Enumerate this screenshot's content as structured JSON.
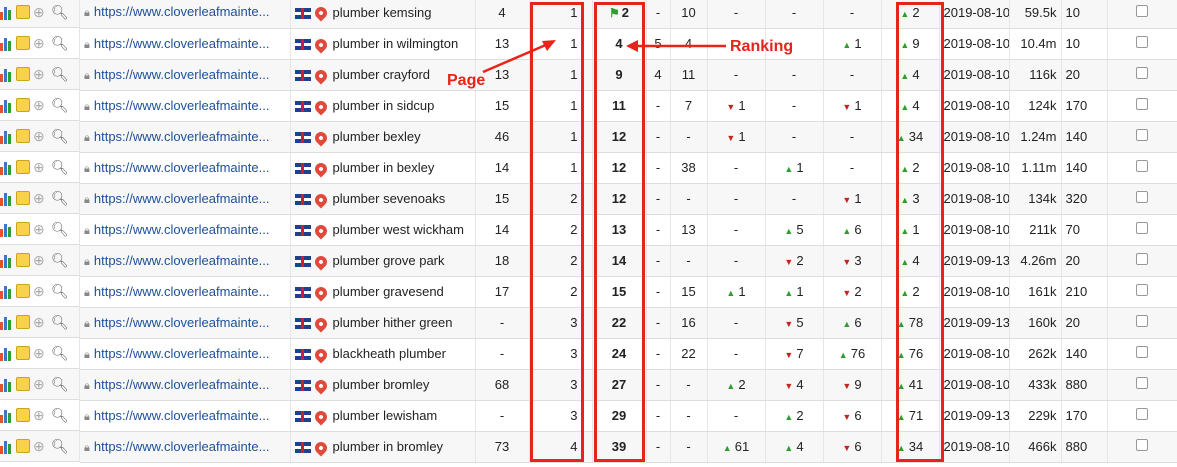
{
  "colors": {
    "annotation": "#e8231a",
    "up": "#2f9e2f",
    "down": "#c8231c",
    "url": "#1d4f9b"
  },
  "icons": [
    "bar-chart-icon",
    "sticky-note-icon",
    "add-tag-icon",
    "search-icon",
    "lock-icon",
    "uk-flag-icon",
    "map-pin-icon",
    "arrow-up-icon",
    "arrow-down-icon",
    "green-flag-icon"
  ],
  "annotations": {
    "page_label": "Page",
    "ranking_label": "Ranking"
  },
  "rows": [
    {
      "url": "https://www.cloverleafmainte...",
      "keyword": "plumber kemsing",
      "col1": "4",
      "page": "1",
      "rank": "2",
      "rank_flag": true,
      "c1": "-",
      "c2": "10",
      "c3": "-",
      "c3d": "",
      "c4": "-",
      "c4d": "",
      "c5": "-",
      "c5d": "",
      "c6": "2",
      "c6d": "up",
      "date": "2019-08-10",
      "vol": "59.5k",
      "cpc": "10"
    },
    {
      "url": "https://www.cloverleafmainte...",
      "keyword": "plumber in wilmington",
      "col1": "13",
      "page": "1",
      "rank": "4",
      "rank_flag": false,
      "c1": "5",
      "c2": "4",
      "c3": "",
      "c3d": "",
      "c4": "",
      "c4d": "",
      "c5": "1",
      "c5d": "up",
      "c6": "9",
      "c6d": "up",
      "date": "2019-08-10",
      "vol": "10.4m",
      "cpc": "10"
    },
    {
      "url": "https://www.cloverleafmainte...",
      "keyword": "plumber crayford",
      "col1": "13",
      "page": "1",
      "rank": "9",
      "rank_flag": false,
      "c1": "4",
      "c2": "11",
      "c3": "-",
      "c3d": "",
      "c4": "-",
      "c4d": "",
      "c5": "-",
      "c5d": "",
      "c6": "4",
      "c6d": "up",
      "date": "2019-08-10",
      "vol": "116k",
      "cpc": "20"
    },
    {
      "url": "https://www.cloverleafmainte...",
      "keyword": "plumber in sidcup",
      "col1": "15",
      "page": "1",
      "rank": "11",
      "rank_flag": false,
      "c1": "-",
      "c2": "7",
      "c3": "1",
      "c3d": "down",
      "c4": "-",
      "c4d": "",
      "c5": "1",
      "c5d": "down",
      "c6": "4",
      "c6d": "up",
      "date": "2019-08-10",
      "vol": "124k",
      "cpc": "170"
    },
    {
      "url": "https://www.cloverleafmainte...",
      "keyword": "plumber bexley",
      "col1": "46",
      "page": "1",
      "rank": "12",
      "rank_flag": false,
      "c1": "-",
      "c2": "-",
      "c3": "1",
      "c3d": "down",
      "c4": "-",
      "c4d": "",
      "c5": "-",
      "c5d": "",
      "c6": "34",
      "c6d": "up",
      "date": "2019-08-10",
      "vol": "1.24m",
      "cpc": "140"
    },
    {
      "url": "https://www.cloverleafmainte...",
      "keyword": "plumber in bexley",
      "col1": "14",
      "page": "1",
      "rank": "12",
      "rank_flag": false,
      "c1": "-",
      "c2": "38",
      "c3": "-",
      "c3d": "",
      "c4": "1",
      "c4d": "up",
      "c5": "-",
      "c5d": "",
      "c6": "2",
      "c6d": "up",
      "date": "2019-08-10",
      "vol": "1.11m",
      "cpc": "140"
    },
    {
      "url": "https://www.cloverleafmainte...",
      "keyword": "plumber sevenoaks",
      "col1": "15",
      "page": "2",
      "rank": "12",
      "rank_flag": false,
      "c1": "-",
      "c2": "-",
      "c3": "-",
      "c3d": "",
      "c4": "-",
      "c4d": "",
      "c5": "1",
      "c5d": "down",
      "c6": "3",
      "c6d": "up",
      "date": "2019-08-10",
      "vol": "134k",
      "cpc": "320"
    },
    {
      "url": "https://www.cloverleafmainte...",
      "keyword": "plumber west wickham",
      "col1": "14",
      "page": "2",
      "rank": "13",
      "rank_flag": false,
      "c1": "-",
      "c2": "13",
      "c3": "-",
      "c3d": "",
      "c4": "5",
      "c4d": "up",
      "c5": "6",
      "c5d": "up",
      "c6": "1",
      "c6d": "up",
      "date": "2019-08-10",
      "vol": "211k",
      "cpc": "70"
    },
    {
      "url": "https://www.cloverleafmainte...",
      "keyword": "plumber grove park",
      "col1": "18",
      "page": "2",
      "rank": "14",
      "rank_flag": false,
      "c1": "-",
      "c2": "-",
      "c3": "-",
      "c3d": "",
      "c4": "2",
      "c4d": "down",
      "c5": "3",
      "c5d": "down",
      "c6": "4",
      "c6d": "up",
      "date": "2019-09-13",
      "vol": "4.26m",
      "cpc": "20"
    },
    {
      "url": "https://www.cloverleafmainte...",
      "keyword": "plumber gravesend",
      "col1": "17",
      "page": "2",
      "rank": "15",
      "rank_flag": false,
      "c1": "-",
      "c2": "15",
      "c3": "1",
      "c3d": "up",
      "c4": "1",
      "c4d": "up",
      "c5": "2",
      "c5d": "down",
      "c6": "2",
      "c6d": "up",
      "date": "2019-08-10",
      "vol": "161k",
      "cpc": "210"
    },
    {
      "url": "https://www.cloverleafmainte...",
      "keyword": "plumber hither green",
      "col1": "-",
      "page": "3",
      "rank": "22",
      "rank_flag": false,
      "c1": "-",
      "c2": "16",
      "c3": "-",
      "c3d": "",
      "c4": "5",
      "c4d": "down",
      "c5": "6",
      "c5d": "up",
      "c6": "78",
      "c6d": "up",
      "date": "2019-09-13",
      "vol": "160k",
      "cpc": "20"
    },
    {
      "url": "https://www.cloverleafmainte...",
      "keyword": "blackheath plumber",
      "col1": "-",
      "page": "3",
      "rank": "24",
      "rank_flag": false,
      "c1": "-",
      "c2": "22",
      "c3": "-",
      "c3d": "",
      "c4": "7",
      "c4d": "down",
      "c5": "76",
      "c5d": "up",
      "c6": "76",
      "c6d": "up",
      "date": "2019-08-10",
      "vol": "262k",
      "cpc": "140"
    },
    {
      "url": "https://www.cloverleafmainte...",
      "keyword": "plumber bromley",
      "col1": "68",
      "page": "3",
      "rank": "27",
      "rank_flag": false,
      "c1": "-",
      "c2": "-",
      "c3": "2",
      "c3d": "up",
      "c4": "4",
      "c4d": "down",
      "c5": "9",
      "c5d": "down",
      "c6": "41",
      "c6d": "up",
      "date": "2019-08-10",
      "vol": "433k",
      "cpc": "880"
    },
    {
      "url": "https://www.cloverleafmainte...",
      "keyword": "plumber lewisham",
      "col1": "-",
      "page": "3",
      "rank": "29",
      "rank_flag": false,
      "c1": "-",
      "c2": "-",
      "c3": "-",
      "c3d": "",
      "c4": "2",
      "c4d": "up",
      "c5": "6",
      "c5d": "down",
      "c6": "71",
      "c6d": "up",
      "date": "2019-09-13",
      "vol": "229k",
      "cpc": "170"
    },
    {
      "url": "https://www.cloverleafmainte...",
      "keyword": "plumber in bromley",
      "col1": "73",
      "page": "4",
      "rank": "39",
      "rank_flag": false,
      "c1": "-",
      "c2": "-",
      "c3": "61",
      "c3d": "up",
      "c4": "4",
      "c4d": "up",
      "c5": "6",
      "c5d": "down",
      "c6": "34",
      "c6d": "up",
      "date": "2019-08-10",
      "vol": "466k",
      "cpc": "880"
    }
  ]
}
